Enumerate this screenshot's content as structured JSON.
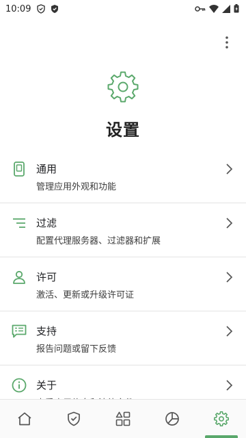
{
  "status_bar": {
    "time": "10:09"
  },
  "page": {
    "title": "设置"
  },
  "settings": {
    "items": [
      {
        "title": "通用",
        "subtitle": "管理应用外观和功能",
        "icon": "phone-icon"
      },
      {
        "title": "过滤",
        "subtitle": "配置代理服务器、过滤器和扩展",
        "icon": "filter-icon"
      },
      {
        "title": "许可",
        "subtitle": "激活、更新或升级许可证",
        "icon": "person-icon"
      },
      {
        "title": "支持",
        "subtitle": "报告问题或留下反馈",
        "icon": "chat-icon"
      },
      {
        "title": "关于",
        "subtitle": "查看应用信息和法律文件",
        "icon": "info-icon"
      }
    ]
  },
  "bottom_nav": {
    "items": [
      "home-icon",
      "shield-icon",
      "apps-icon",
      "stats-icon",
      "gear-icon"
    ],
    "active": "gear-icon"
  },
  "colors": {
    "accent": "#5aa86b",
    "text": "#202124"
  }
}
